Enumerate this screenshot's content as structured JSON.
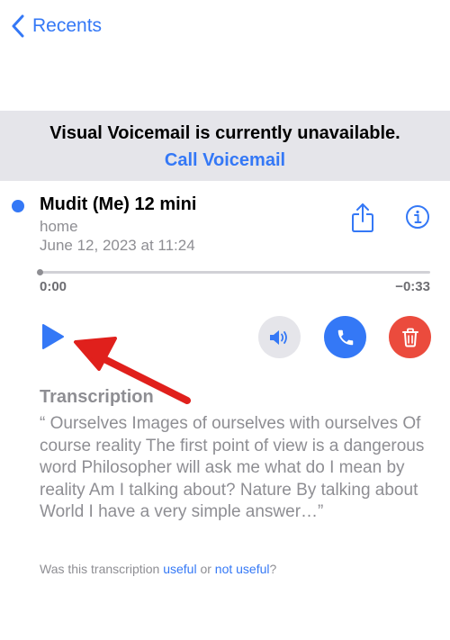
{
  "nav": {
    "back_label": "Recents"
  },
  "banner": {
    "message": "Visual Voicemail is currently unavailable.",
    "link_label": "Call Voicemail"
  },
  "voicemail": {
    "caller_name": "Mudit (Me) 12 mini",
    "label": "home",
    "date": "June 12, 2023 at 11:24",
    "time_elapsed": "0:00",
    "time_remaining": "−0:33",
    "progress": 0
  },
  "controls": {
    "play_icon": "play-icon",
    "speaker_icon": "speaker-icon",
    "call_icon": "phone-icon",
    "delete_icon": "trash-icon"
  },
  "transcription": {
    "heading": "Transcription",
    "text": "“ Ourselves Images of ourselves with ourselves Of course reality The first point of view is a dangerous word Philosopher will ask me what do I mean by reality Am I talking about? Nature By talking about World I have a very simple answer…”",
    "feedback_prefix": "Was this transcription ",
    "useful_label": "useful",
    "feedback_or": " or ",
    "not_useful_label": "not useful",
    "feedback_suffix": "?"
  },
  "colors": {
    "accent": "#3478f6",
    "delete": "#eb4b3d",
    "banner_bg": "#e5e5ea",
    "secondary_text": "#8e8e93",
    "annotation": "#e0201c"
  }
}
